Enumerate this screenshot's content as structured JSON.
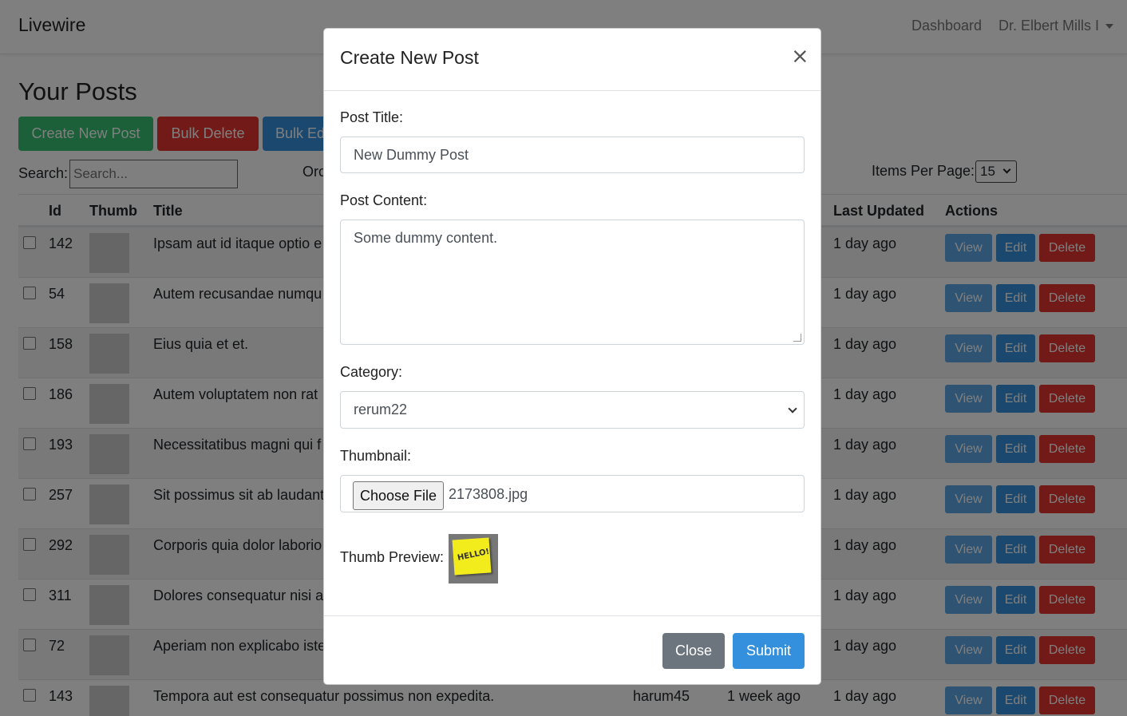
{
  "navbar": {
    "brand": "Livewire",
    "dashboard_link": "Dashboard",
    "user_name": "Dr. Elbert Mills I"
  },
  "page": {
    "heading": "Your Posts",
    "create_button": "Create New Post",
    "bulk_delete_button": "Bulk Delete",
    "bulk_edit_button": "Bulk Ed",
    "search_label": "Search:",
    "search_placeholder": "Search...",
    "order_label": "Orc",
    "items_per_page_label": "Items Per Page:",
    "items_per_page_value": "15"
  },
  "table": {
    "headers": {
      "id": "Id",
      "thumb": "Thumb",
      "title": "Title",
      "last_updated": "Last Updated",
      "actions": "Actions"
    },
    "action_labels": {
      "view": "View",
      "edit": "Edit",
      "delete": "Delete"
    },
    "rows": [
      {
        "id": "142",
        "title": "Ipsam aut id itaque optio e",
        "category": "",
        "created": "",
        "updated": "1 day ago"
      },
      {
        "id": "54",
        "title": "Autem recusandae numqu",
        "category": "",
        "created": "",
        "updated": "1 day ago"
      },
      {
        "id": "158",
        "title": "Eius quia et et.",
        "category": "",
        "created": "",
        "updated": "1 day ago"
      },
      {
        "id": "186",
        "title": "Autem voluptatem non rat",
        "category": "",
        "created": "",
        "updated": "1 day ago"
      },
      {
        "id": "193",
        "title": "Necessitatibus magni qui f",
        "category": "",
        "created": "",
        "updated": "1 day ago"
      },
      {
        "id": "257",
        "title": "Sit possimus sit ab laudant",
        "category": "",
        "created": "",
        "updated": "1 day ago"
      },
      {
        "id": "292",
        "title": "Corporis quia dolor laborio",
        "category": "",
        "created": "",
        "updated": "1 day ago"
      },
      {
        "id": "311",
        "title": "Dolores consequatur nisi a",
        "category": "",
        "created": "",
        "updated": "1 day ago"
      },
      {
        "id": "72",
        "title": "Aperiam non explicabo iste",
        "category": "",
        "created": "",
        "updated": "1 day ago"
      },
      {
        "id": "143",
        "title": "Tempora aut est consequatur possimus non expedita.",
        "category": "harum45",
        "created": "1 week ago",
        "updated": "1 day ago"
      }
    ]
  },
  "modal": {
    "title": "Create New Post",
    "close_symbol": "×",
    "post_title_label": "Post Title:",
    "post_title_value": "New Dummy Post",
    "post_content_label": "Post Content:",
    "post_content_value": "Some dummy content.",
    "category_label": "Category:",
    "category_value": "rerum22",
    "thumbnail_label": "Thumbnail:",
    "choose_file_label": "Choose File",
    "file_name": "2173808.jpg",
    "thumb_preview_label": "Thumb Preview:",
    "close_button": "Close",
    "submit_button": "Submit"
  }
}
